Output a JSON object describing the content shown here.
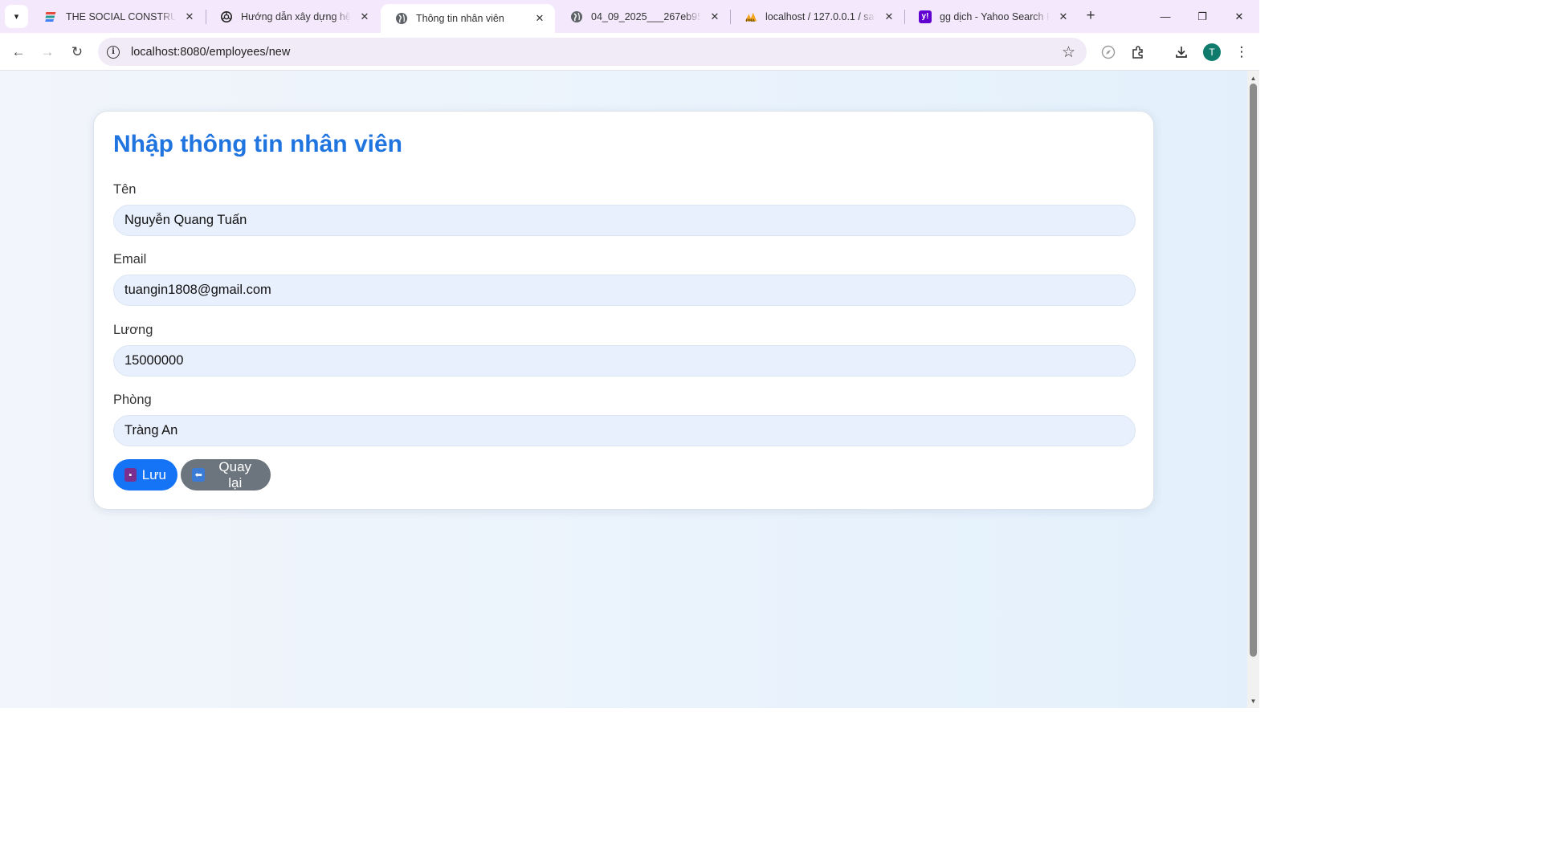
{
  "browser": {
    "tabs": [
      {
        "title": "THE SOCIAL CONSTRUCTIV",
        "icon": "colorful-stripes-favicon-icon",
        "active": false
      },
      {
        "title": "Hướng dẫn xây dựng hệ th",
        "icon": "openai-favicon-icon",
        "active": false
      },
      {
        "title": "Thông tin nhân viên",
        "icon": "globe-favicon-icon",
        "active": true
      },
      {
        "title": "04_09_2025___267eb95ab4",
        "icon": "globe-favicon-icon",
        "active": false
      },
      {
        "title": "localhost / 127.0.0.1 / salar",
        "icon": "phpmyadmin-favicon-icon",
        "active": false
      },
      {
        "title": "gg dịch - Yahoo Search Re",
        "icon": "yahoo-favicon-icon",
        "active": false
      }
    ],
    "url": "localhost:8080/employees/new",
    "profile_initial": "T",
    "colors": {
      "tabstrip": "#f3e8fc",
      "omnibox": "#f1ebf7",
      "avatar": "#0f7b6c"
    }
  },
  "page": {
    "title": "Nhập thông tin nhân viên",
    "fields": {
      "name": {
        "label": "Tên",
        "value": "Nguyễn Quang Tuấn"
      },
      "email": {
        "label": "Email",
        "value": "tuangin1808@gmail.com"
      },
      "salary": {
        "label": "Lương",
        "value": "15000000"
      },
      "department": {
        "label": "Phòng",
        "value": "Tràng An"
      }
    },
    "buttons": {
      "save": {
        "label": "Lưu",
        "icon": "floppy-disk-icon"
      },
      "back": {
        "label": "Quay lại",
        "icon": "back-arrow-icon"
      }
    },
    "colors": {
      "title": "#1f74e0",
      "save_button": "#1573f6",
      "back_button": "#6c757d",
      "input_background": "#e9f0fd"
    }
  }
}
